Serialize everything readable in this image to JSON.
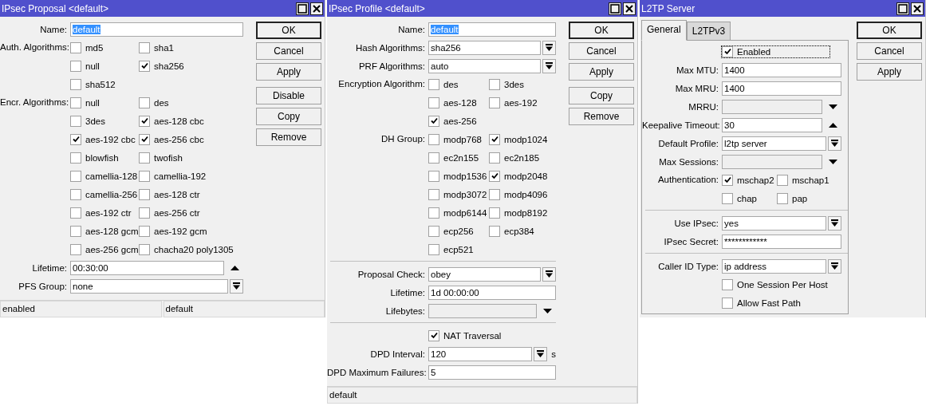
{
  "windows": [
    {
      "title": "IPsec Proposal <default>",
      "rows": [
        {
          "kind": "text",
          "label": "Name:",
          "value": "default",
          "highlighted": true
        },
        {
          "kind": "checks",
          "label": "Auth. Algorithms:",
          "options": [
            {
              "label": "md5",
              "checked": false
            },
            {
              "label": "sha1",
              "checked": false
            },
            {
              "label": "null",
              "checked": false
            },
            {
              "label": "sha256",
              "checked": true
            },
            {
              "label": "sha512",
              "checked": false
            }
          ]
        },
        {
          "kind": "checks",
          "label": "Encr. Algorithms:",
          "options": [
            {
              "label": "null",
              "checked": false
            },
            {
              "label": "des",
              "checked": false
            },
            {
              "label": "3des",
              "checked": false
            },
            {
              "label": "aes-128 cbc",
              "checked": true
            },
            {
              "label": "aes-192 cbc",
              "checked": true
            },
            {
              "label": "aes-256 cbc",
              "checked": true
            },
            {
              "label": "blowfish",
              "checked": false
            },
            {
              "label": "twofish",
              "checked": false
            },
            {
              "label": "camellia-128",
              "checked": false
            },
            {
              "label": "camellia-192",
              "checked": false
            },
            {
              "label": "camellia-256",
              "checked": false
            },
            {
              "label": "aes-128 ctr",
              "checked": false
            },
            {
              "label": "aes-192 ctr",
              "checked": false
            },
            {
              "label": "aes-256 ctr",
              "checked": false
            },
            {
              "label": "aes-128 gcm",
              "checked": false
            },
            {
              "label": "aes-192 gcm",
              "checked": false
            },
            {
              "label": "aes-256 gcm",
              "checked": false
            },
            {
              "label": "chacha20 poly1305",
              "checked": false
            }
          ]
        },
        {
          "kind": "collapse",
          "label": "Lifetime:",
          "value": "00:30:00"
        },
        {
          "kind": "select",
          "label": "PFS Group:",
          "value": "none"
        }
      ],
      "buttons": [
        [
          {
            "label": "OK",
            "default": true
          },
          {
            "label": "Cancel",
            "default": false
          },
          {
            "label": "Apply",
            "default": false
          }
        ],
        [
          {
            "label": "Disable",
            "default": false
          },
          {
            "label": "Copy",
            "default": false
          },
          {
            "label": "Remove",
            "default": false
          }
        ]
      ],
      "status": [
        "enabled",
        "default"
      ]
    },
    {
      "title": "IPsec Profile <default>",
      "rows": [
        {
          "kind": "text",
          "label": "Name:",
          "value": "default",
          "highlighted": true
        },
        {
          "kind": "select",
          "label": "Hash Algorithms:",
          "value": "sha256"
        },
        {
          "kind": "select",
          "label": "PRF Algorithms:",
          "value": "auto"
        },
        {
          "kind": "checks",
          "label": "Encryption Algorithm:",
          "options": [
            {
              "label": "des",
              "checked": false
            },
            {
              "label": "3des",
              "checked": false
            },
            {
              "label": "aes-128",
              "checked": false
            },
            {
              "label": "aes-192",
              "checked": false
            },
            {
              "label": "aes-256",
              "checked": true
            }
          ]
        },
        {
          "kind": "checks",
          "label": "DH Group:",
          "options": [
            {
              "label": "modp768",
              "checked": false
            },
            {
              "label": "modp1024",
              "checked": true
            },
            {
              "label": "ec2n155",
              "checked": false
            },
            {
              "label": "ec2n185",
              "checked": false
            },
            {
              "label": "modp1536",
              "checked": false
            },
            {
              "label": "modp2048",
              "checked": true
            },
            {
              "label": "modp3072",
              "checked": false
            },
            {
              "label": "modp4096",
              "checked": false
            },
            {
              "label": "modp6144",
              "checked": false
            },
            {
              "label": "modp8192",
              "checked": false
            },
            {
              "label": "ecp256",
              "checked": false
            },
            {
              "label": "ecp384",
              "checked": false
            },
            {
              "label": "ecp521",
              "checked": false
            }
          ]
        },
        {
          "kind": "separator"
        },
        {
          "kind": "select",
          "label": "Proposal Check:",
          "value": "obey"
        },
        {
          "kind": "text",
          "label": "Lifetime:",
          "value": "1d 00:00:00"
        },
        {
          "kind": "expand",
          "label": "Lifebytes:"
        },
        {
          "kind": "separator"
        },
        {
          "kind": "check",
          "label": "NAT Traversal",
          "checked": true
        },
        {
          "kind": "select",
          "label": "DPD Interval:",
          "value": "120",
          "unit": "s"
        },
        {
          "kind": "text",
          "label": "DPD Maximum Failures:",
          "value": "5"
        }
      ],
      "buttons": [
        [
          {
            "label": "OK",
            "default": true
          },
          {
            "label": "Cancel",
            "default": false
          },
          {
            "label": "Apply",
            "default": false
          }
        ],
        [
          {
            "label": "Copy",
            "default": false
          },
          {
            "label": "Remove",
            "default": false
          }
        ]
      ],
      "status": [
        "default"
      ]
    },
    {
      "title": "L2TP Server",
      "tabs": [
        {
          "label": "General",
          "selected": true
        },
        {
          "label": "L2TPv3",
          "selected": false
        }
      ],
      "rows": [
        {
          "kind": "check",
          "label": "Enabled",
          "checked": true,
          "focused": true
        },
        {
          "kind": "text",
          "label": "Max MTU:",
          "value": "1400"
        },
        {
          "kind": "text",
          "label": "Max MRU:",
          "value": "1400"
        },
        {
          "kind": "expand",
          "label": "MRRU:"
        },
        {
          "kind": "collapse",
          "label": "Keepalive Timeout:",
          "value": "30"
        },
        {
          "kind": "select",
          "label": "Default Profile:",
          "value": "l2tp server"
        },
        {
          "kind": "expand",
          "label": "Max Sessions:"
        },
        {
          "kind": "checks",
          "label": "Authentication:",
          "options": [
            {
              "label": "mschap2",
              "checked": true
            },
            {
              "label": "mschap1",
              "checked": false
            },
            {
              "label": "chap",
              "checked": false
            },
            {
              "label": "pap",
              "checked": false
            }
          ]
        },
        {
          "kind": "separator"
        },
        {
          "kind": "select",
          "label": "Use IPsec:",
          "value": "yes"
        },
        {
          "kind": "text",
          "label": "IPsec Secret:",
          "value": "************"
        },
        {
          "kind": "separator"
        },
        {
          "kind": "select",
          "label": "Caller ID Type:",
          "value": "ip address"
        },
        {
          "kind": "check",
          "label": "One Session Per Host",
          "checked": false
        },
        {
          "kind": "check",
          "label": "Allow Fast Path",
          "checked": false
        }
      ],
      "buttons": [
        [
          {
            "label": "OK",
            "default": true
          },
          {
            "label": "Cancel",
            "default": false
          },
          {
            "label": "Apply",
            "default": false
          }
        ]
      ]
    }
  ]
}
